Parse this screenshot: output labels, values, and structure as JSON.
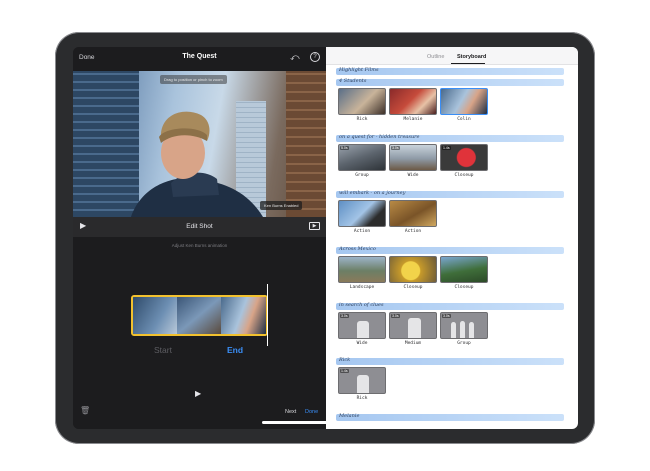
{
  "editor": {
    "done_label": "Done",
    "project_title": "The Quest",
    "undo_glyph": "⤺",
    "help_glyph": "?",
    "preview_hint": "Drag to position or pinch to zoom",
    "ken_burns_badge": "Ken Burns Enabled",
    "play_glyph": "▶",
    "edit_shot_label": "Edit Shot",
    "sub_hint": "Adjust Ken Burns animation",
    "start_label": "Start",
    "end_label": "End",
    "next_label": "Next",
    "done_label_2": "Done",
    "trash_glyph": "🗑",
    "fullscreen_glyph": "▶"
  },
  "storyboard": {
    "tabs": [
      {
        "label": "Outline",
        "active": false
      },
      {
        "label": "Storyboard",
        "active": true
      }
    ],
    "sections": [
      {
        "heading": "Highlight Films",
        "shots": []
      },
      {
        "heading": "4 Students",
        "shots": [
          {
            "caption": "Rick",
            "selected": false
          },
          {
            "caption": "Melanie",
            "selected": false
          },
          {
            "caption": "Colin",
            "selected": true
          }
        ]
      },
      {
        "heading": "on a quest for - hidden treasure",
        "shots": [
          {
            "caption": "Group",
            "badge": "5.0s"
          },
          {
            "caption": "Wide",
            "badge": "3.0s"
          },
          {
            "caption": "Closeup",
            "badge": "1.4s"
          }
        ]
      },
      {
        "heading": "will embark - on a journey",
        "shots": [
          {
            "caption": "Action"
          },
          {
            "caption": "Action"
          }
        ]
      },
      {
        "heading": "Across Mexico",
        "shots": [
          {
            "caption": "Landscape"
          },
          {
            "caption": "Closeup"
          },
          {
            "caption": "Closeup"
          }
        ]
      },
      {
        "heading": "in search of clues",
        "shots": [
          {
            "caption": "Wide",
            "badge": "3.0s"
          },
          {
            "caption": "Medium",
            "badge": "3.0s"
          },
          {
            "caption": "Group",
            "badge": "3.0s"
          }
        ]
      },
      {
        "heading": "Rick",
        "shots": [
          {
            "caption": "Rick",
            "badge": "1.4s"
          }
        ]
      },
      {
        "heading": "Melanie",
        "shots": []
      }
    ]
  },
  "colors": {
    "accent": "#3a8ef6",
    "trim_handle": "#f2c12e",
    "highlight": "#8cb6eb"
  }
}
